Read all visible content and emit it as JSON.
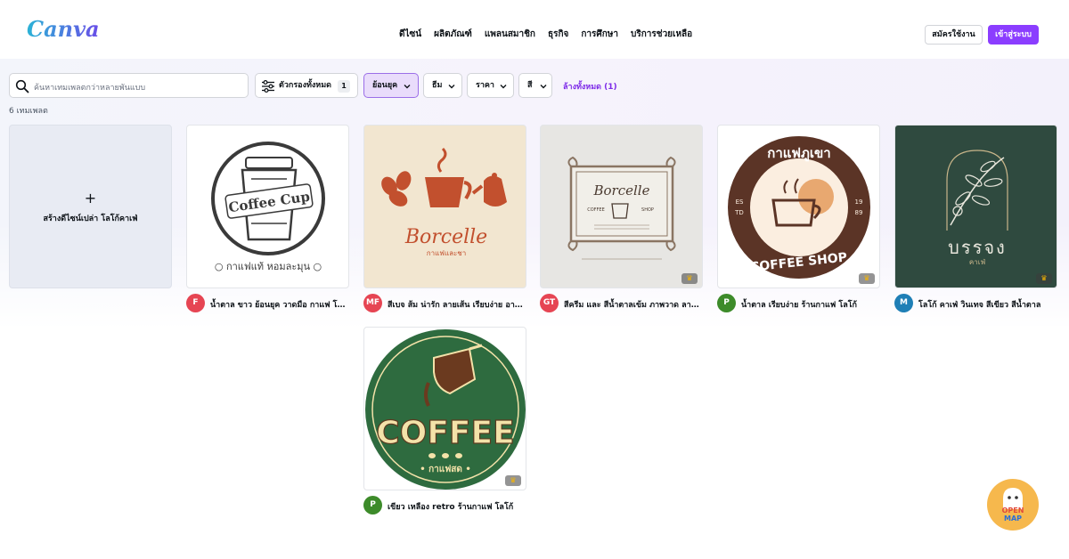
{
  "header": {
    "logo": "Canva",
    "nav": [
      "ดีไซน์",
      "ผลิตภัณฑ์",
      "แพลนสมาชิก",
      "ธุรกิจ",
      "การศึกษา",
      "บริการช่วยเหลือ"
    ],
    "signup_label": "สมัครใช้งาน",
    "login_label": "เข้าสู่ระบบ"
  },
  "filters": {
    "search_placeholder": "ค้นหาเทมเพลตกว่าหลายพันแบบ",
    "all_filters_label": "ตัวกรองทั้งหมด",
    "all_filters_count": "1",
    "chips": [
      "ย้อนยุค",
      "ธีม",
      "ราคา",
      "สี"
    ],
    "clear_all": "ล้างทั้งหมด (1)"
  },
  "result_count": "6 เทมเพลต",
  "create_card": {
    "plus": "+",
    "label": "สร้างดีไซน์เปล่า โลโก้คาเฟ่"
  },
  "templates": [
    {
      "title": "น้ำตาล ขาว ย้อนยุค วาดมือ กาแฟ โลโก้",
      "avatar": "F",
      "avatar_color": "#e64553",
      "premium": false,
      "art_text": [
        "Coffee Cup",
        "○ กาแฟแท้ หอมละมุน ○"
      ]
    },
    {
      "title": "สีเบจ ส้ม น่ารัก ลายเส้น เรียบง่าย อาหารและเครื่องดื่ม โลโก้",
      "avatar": "MF",
      "avatar_color": "#e64553",
      "premium": false,
      "art_text": [
        "Borcelle",
        "กาแฟและชา"
      ]
    },
    {
      "title": "สีครีม และ สีน้ำตาลเข้ม ภาพวาด ลายเส้น โลโก้",
      "avatar": "GT",
      "avatar_color": "#e64553",
      "premium": true,
      "art_text": [
        "Borcelle",
        "COFFEE",
        "SHOP"
      ]
    },
    {
      "title": "น้ำตาล เรียบง่าย ร้านกาแฟ โลโก้",
      "avatar": "P",
      "avatar_color": "#3d8b2a",
      "premium": true,
      "art_text": [
        "กาแฟภูเขา",
        "COFFEE SHOP",
        "ES",
        "TD",
        "19",
        "89"
      ]
    },
    {
      "title": "โลโก้ คาเฟ่ วินเทจ สีเขียว สีน้ำตาล",
      "avatar": "M",
      "avatar_color": "#1f7fb6",
      "premium": true,
      "art_text": [
        "บรรจง",
        "คาเฟ่"
      ]
    },
    {
      "title": "เขียว เหลือง retro ร้านกาแฟ โลโก้",
      "avatar": "P",
      "avatar_color": "#3d8b2a",
      "premium": true,
      "art_text": [
        "COFFEE",
        "• กาแฟสด •"
      ]
    }
  ],
  "map_badge": [
    "OPEN",
    "MAP"
  ],
  "colors": {
    "accent": "#8b3dff",
    "accent_text": "#7d2ae8",
    "active_chip_bg": "#e9dcfb",
    "create_card_bg": "#e8ebf3"
  },
  "icons": [
    "search-icon",
    "filter-sliders-icon",
    "chevron-down-icon",
    "crown-icon",
    "plus-icon"
  ]
}
